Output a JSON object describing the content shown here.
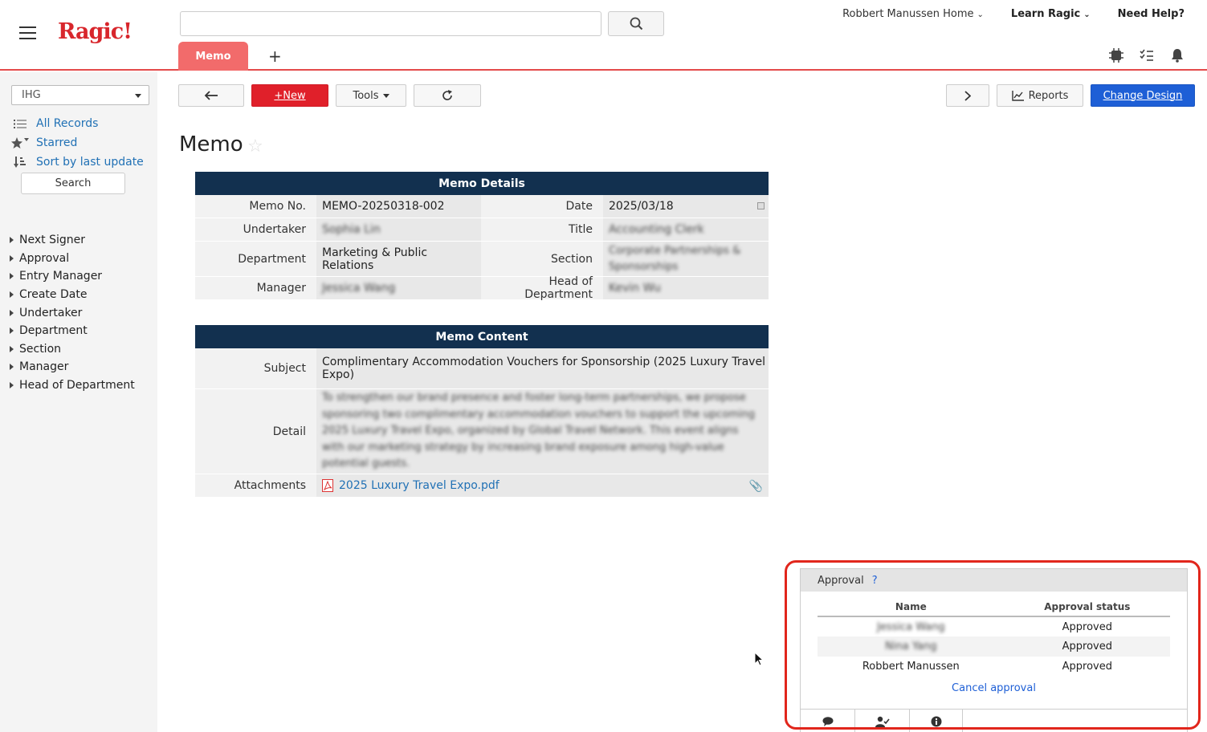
{
  "header": {
    "logo": "Ragic!",
    "search_value": "",
    "links": {
      "home": "Robbert Manussen Home",
      "learn": "Learn Ragic",
      "help": "Need Help?"
    },
    "active_tab": "Memo",
    "add_tab": "+"
  },
  "sidebar": {
    "selector": "IHG",
    "links": [
      {
        "label": "All Records",
        "icon": "list-icon"
      },
      {
        "label": "Starred",
        "icon": "star-icon"
      },
      {
        "label": "Sort by last update",
        "icon": "sort-icon"
      }
    ],
    "search_button": "Search",
    "groups": [
      "Next Signer",
      "Approval",
      "Entry Manager",
      "Create Date",
      "Undertaker",
      "Department",
      "Section",
      "Manager",
      "Head of Department"
    ]
  },
  "toolbar": {
    "new_label": "+New",
    "tools_label": "Tools",
    "reports_label": "Reports",
    "change_design_label": "Change Design"
  },
  "page_title": "Memo",
  "memo_details": {
    "heading": "Memo Details",
    "fields": {
      "memo_no_label": "Memo No.",
      "memo_no": "MEMO-20250318-002",
      "date_label": "Date",
      "date": "2025/03/18",
      "undertaker_label": "Undertaker",
      "undertaker": "Sophia Lin",
      "title_label": "Title",
      "title": "Accounting Clerk",
      "department_label": "Department",
      "department": "Marketing & Public Relations",
      "section_label": "Section",
      "section": "Corporate Partnerships & Sponsorships",
      "manager_label": "Manager",
      "manager": "Jessica Wang",
      "head_label": "Head of Department",
      "head": "Kevin Wu"
    }
  },
  "memo_content": {
    "heading": "Memo Content",
    "subject_label": "Subject",
    "subject": "Complimentary Accommodation Vouchers for Sponsorship (2025 Luxury Travel Expo)",
    "detail_label": "Detail",
    "detail": "To strengthen our brand presence and foster long-term partnerships, we propose sponsoring two complimentary accommodation vouchers to support the upcoming 2025 Luxury Travel Expo, organized by Global Travel Network. This event aligns with our marketing strategy by increasing brand exposure among high-value potential guests.",
    "attachments_label": "Attachments",
    "attachment": "2025 Luxury Travel Expo.pdf"
  },
  "approval": {
    "title": "Approval",
    "help": "?",
    "col_name": "Name",
    "col_status": "Approval status",
    "rows": [
      {
        "name": "Jessica Wang",
        "status": "Approved"
      },
      {
        "name": "Nina Yang",
        "status": "Approved"
      },
      {
        "name": "Robbert Manussen",
        "status": "Approved"
      }
    ],
    "cancel": "Cancel approval"
  },
  "colors": {
    "brand_red": "#d8262c",
    "new_button": "#e0202a",
    "section_header": "#12304f",
    "primary_blue": "#1e5fd6",
    "highlight_outline": "#e1261c"
  }
}
